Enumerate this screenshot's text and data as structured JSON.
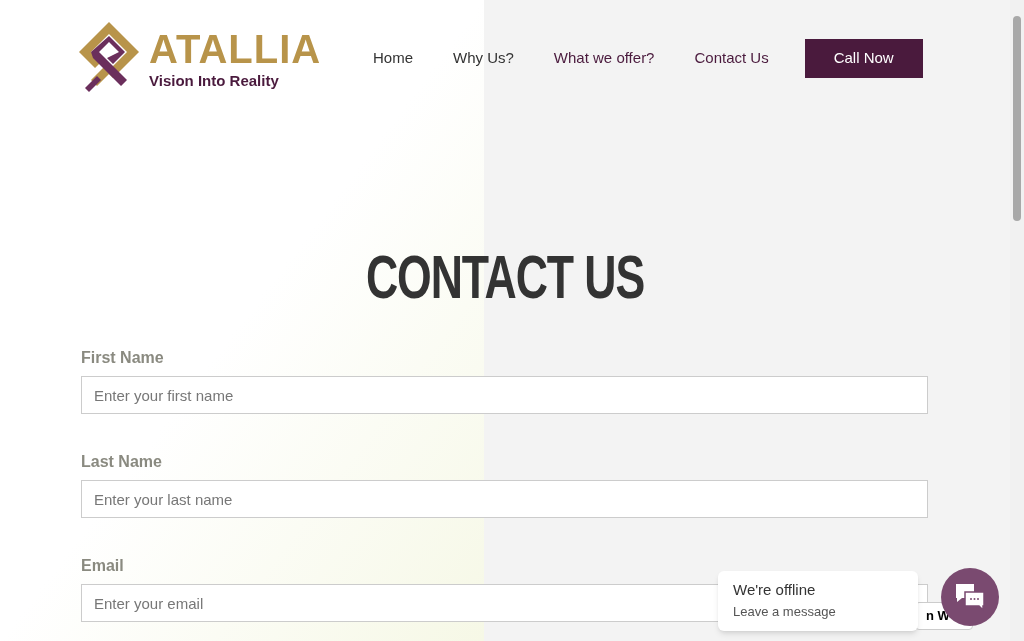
{
  "logo": {
    "name": "ATALLIA",
    "tagline": "Vision Into Reality"
  },
  "nav": [
    {
      "label": "Home",
      "color": "#333333"
    },
    {
      "label": "Why Us?",
      "color": "#333333"
    },
    {
      "label": "What we offer?",
      "color": "#4a1a3d"
    },
    {
      "label": "Contact Us",
      "color": "#4a1a3d"
    }
  ],
  "call_button": "Call Now",
  "heading": "CONTACT US",
  "form": [
    {
      "label": "First Name",
      "placeholder": "Enter your first name"
    },
    {
      "label": "Last Name",
      "placeholder": "Enter your last name"
    },
    {
      "label": "Email",
      "placeholder": "Enter your email"
    }
  ],
  "partial_button": "n W",
  "chat": {
    "title": "We're offline",
    "subtitle": "Leave a message"
  }
}
